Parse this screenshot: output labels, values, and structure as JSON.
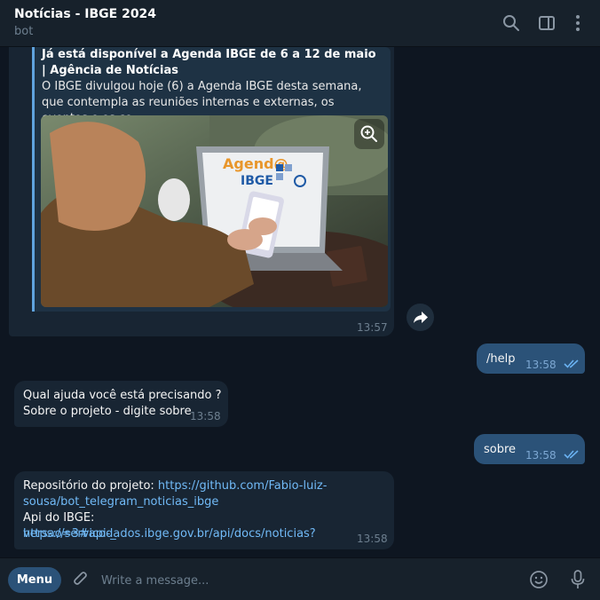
{
  "header": {
    "title": "Notícias - IBGE 2024",
    "subtitle": "bot"
  },
  "messages": {
    "preview": {
      "title": "Já está disponível a Agenda IBGE de 6 a 12 de maio | Agência de Notícias",
      "description": "O IBGE divulgou hoje (6) a Agenda IBGE desta semana, que contempla as reuniões internas e externas, os eventos e os co...",
      "image_logo_line1": "Agend@",
      "image_logo_line2": "IBGE",
      "time": "13:57"
    },
    "help": {
      "text": "/help",
      "time": "13:58"
    },
    "help_reply": {
      "line1": "Qual ajuda você está precisando ?",
      "line2": "Sobre o projeto - digite sobre",
      "time": "13:58"
    },
    "sobre": {
      "text": "sobre",
      "time": "13:58"
    },
    "repo": {
      "label1": "Repositório do projeto: ",
      "link1a": "https://github.com/Fabio-luiz-",
      "link1b": "sousa/bot_telegram_noticias_ibge",
      "label2": "Api do IBGE: ",
      "link2a": "https://servicodados.ibge.gov.br/api/docs/noticias?",
      "link2b": "versao=3#api-_",
      "time": "13:58"
    }
  },
  "composer": {
    "menu_label": "Menu",
    "placeholder": "Write a message..."
  },
  "icons": {
    "search": "search-icon",
    "sidebar": "sidebar-toggle-icon",
    "more": "more-vertical-icon",
    "attach": "paperclip-icon",
    "emoji": "emoji-icon",
    "mic": "microphone-icon",
    "zoom": "zoom-in-icon",
    "forward": "forward-icon",
    "read": "double-check-icon"
  },
  "colors": {
    "background": "#0e1621",
    "incoming": "#182533",
    "outgoing": "#2b5278",
    "link": "#71baf7",
    "accent": "#5fa3de"
  }
}
